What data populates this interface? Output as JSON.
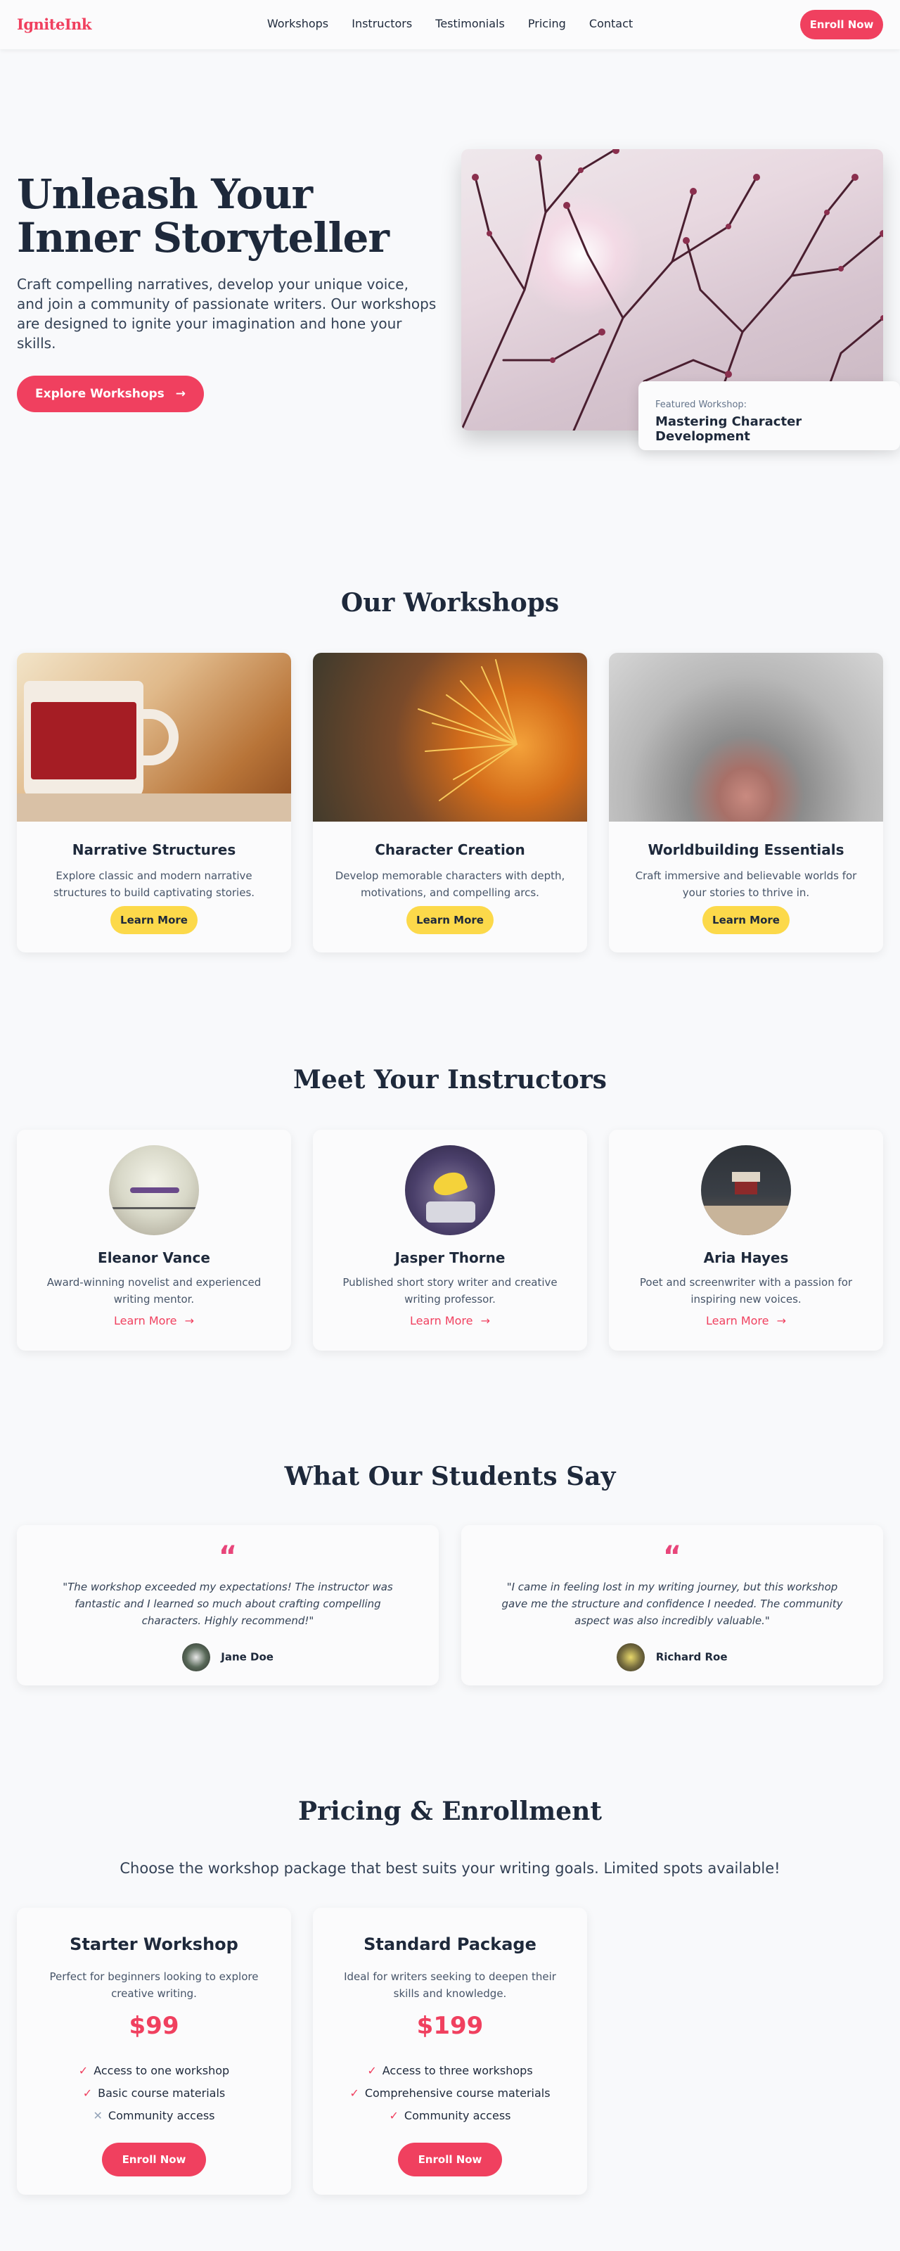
{
  "nav": {
    "logo": "IgniteInk",
    "links": [
      "Workshops",
      "Instructors",
      "Testimonials",
      "Pricing",
      "Contact"
    ],
    "cta": "Enroll Now"
  },
  "hero": {
    "title": "Unleash Your Inner Storyteller",
    "subtitle": "Craft compelling narratives, develop your unique voice, and join a community of passionate writers. Our workshops are designed to ignite your imagination and hone your skills.",
    "button": "Explore Workshops",
    "featured_label": "Featured Workshop:",
    "featured_title": "Mastering Character Development"
  },
  "workshops": {
    "title": "Our Workshops",
    "items": [
      {
        "title": "Narrative Structures",
        "desc": "Explore classic and modern narrative structures to build captivating stories.",
        "button": "Learn More"
      },
      {
        "title": "Character Creation",
        "desc": "Develop memorable characters with depth, motivations, and compelling arcs.",
        "button": "Learn More"
      },
      {
        "title": "Worldbuilding Essentials",
        "desc": "Craft immersive and believable worlds for your stories to thrive in.",
        "button": "Learn More"
      }
    ]
  },
  "instructors": {
    "title": "Meet Your Instructors",
    "items": [
      {
        "name": "Eleanor Vance",
        "bio": "Award-winning novelist and experienced writing mentor.",
        "link": "Learn More"
      },
      {
        "name": "Jasper Thorne",
        "bio": "Published short story writer and creative writing professor.",
        "link": "Learn More"
      },
      {
        "name": "Aria Hayes",
        "bio": "Poet and screenwriter with a passion for inspiring new voices.",
        "link": "Learn More"
      }
    ]
  },
  "testimonials": {
    "title": "What Our Students Say",
    "items": [
      {
        "quote": "\"The workshop exceeded my expectations! The instructor was fantastic and I learned so much about crafting compelling characters. Highly recommend!\"",
        "author": "Jane Doe"
      },
      {
        "quote": "\"I came in feeling lost in my writing journey, but this workshop gave me the structure and confidence I needed. The community aspect was also incredibly valuable.\"",
        "author": "Richard Roe"
      }
    ]
  },
  "pricing": {
    "title": "Pricing & Enrollment",
    "intro": "Choose the workshop package that best suits your writing goals. Limited spots available!",
    "plans": [
      {
        "name": "Starter Workshop",
        "desc": "Perfect for beginners looking to explore creative writing.",
        "price": "$99",
        "features": [
          {
            "text": "Access to one workshop",
            "included": true
          },
          {
            "text": "Basic course materials",
            "included": true
          },
          {
            "text": "Community access",
            "included": false
          }
        ],
        "button": "Enroll Now"
      },
      {
        "name": "Standard Package",
        "desc": "Ideal for writers seeking to deepen their skills and knowledge.",
        "price": "$199",
        "features": [
          {
            "text": "Access to three workshops",
            "included": true
          },
          {
            "text": "Comprehensive course materials",
            "included": true
          },
          {
            "text": "Community access",
            "included": true
          }
        ],
        "button": "Enroll Now"
      }
    ]
  },
  "colors": {
    "accent": "#f0405f",
    "yellow": "#fcd94a",
    "text": "#1e293b"
  },
  "icons": {
    "arrow": "arrow-right-icon",
    "check": "check-icon",
    "cross": "cross-icon",
    "quote": "quote-icon"
  }
}
